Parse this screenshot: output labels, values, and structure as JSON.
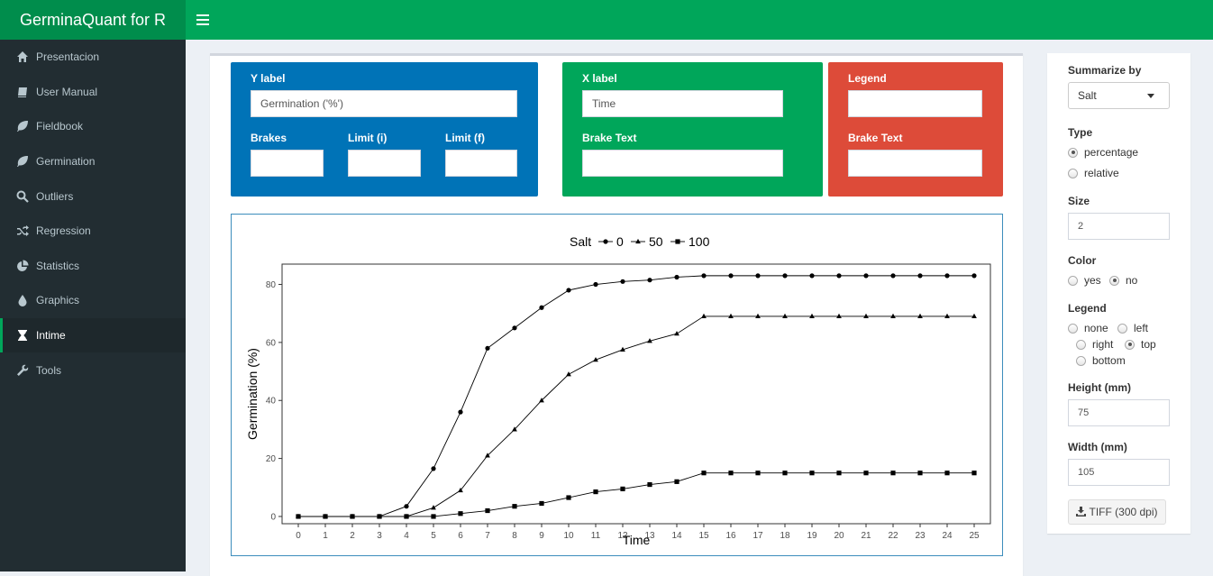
{
  "app": {
    "title": "GerminaQuant for R"
  },
  "sidebar": {
    "items": [
      {
        "label": "Presentacion",
        "icon": "home-icon"
      },
      {
        "label": "User Manual",
        "icon": "book-icon"
      },
      {
        "label": "Fieldbook",
        "icon": "leaf-icon"
      },
      {
        "label": "Germination",
        "icon": "leaf-icon"
      },
      {
        "label": "Outliers",
        "icon": "search-icon"
      },
      {
        "label": "Regression",
        "icon": "random-icon"
      },
      {
        "label": "Statistics",
        "icon": "pie-chart-icon"
      },
      {
        "label": "Graphics",
        "icon": "tint-icon"
      },
      {
        "label": "Intime",
        "icon": "hourglass-icon"
      },
      {
        "label": "Tools",
        "icon": "wrench-icon"
      }
    ],
    "active": "Intime"
  },
  "ylabel_panel": {
    "title": "Y label",
    "value": "Germination ('%')",
    "brakes_label": "Brakes",
    "limit_i_label": "Limit (i)",
    "limit_f_label": "Limit (f)",
    "brakes_value": "",
    "limit_i_value": "",
    "limit_f_value": ""
  },
  "xlabel_panel": {
    "title": "X label",
    "value": "Time",
    "brake_text_label": "Brake Text",
    "brake_text_value": ""
  },
  "legend_panel": {
    "title": "Legend",
    "value": "",
    "brake_text_label": "Brake Text",
    "brake_text_value": ""
  },
  "controls": {
    "summarize_label": "Summarize by",
    "summarize_value": "Salt",
    "type_label": "Type",
    "type_options": [
      "percentage",
      "relative"
    ],
    "type_selected": "percentage",
    "size_label": "Size",
    "size_value": "2",
    "color_label": "Color",
    "color_options": [
      "yes",
      "no"
    ],
    "color_selected": "no",
    "legend_label": "Legend",
    "legend_options": [
      "none",
      "left",
      "right",
      "top",
      "bottom"
    ],
    "legend_selected": "top",
    "height_label": "Height (mm)",
    "height_value": "75",
    "width_label": "Width (mm)",
    "width_value": "105",
    "download_label": "TIFF (300 dpi)"
  },
  "colors": {
    "header": "#00a65a",
    "logo_bg": "#008d4c",
    "sidebar": "#222d32",
    "panel_blue": "#0073b7",
    "panel_green": "#00a65a",
    "panel_red": "#dd4b39"
  },
  "chart_data": {
    "type": "line",
    "xlabel": "Time",
    "ylabel": "Germination (%)",
    "legend_title": "Salt",
    "legend_position": "top",
    "x": [
      0,
      1,
      2,
      3,
      4,
      5,
      6,
      7,
      8,
      9,
      10,
      11,
      12,
      13,
      14,
      15,
      16,
      17,
      18,
      19,
      20,
      21,
      22,
      23,
      24,
      25
    ],
    "xlim": [
      -0.6,
      25.6
    ],
    "ylim": [
      -2.5,
      87
    ],
    "yticks": [
      0,
      20,
      40,
      60,
      80
    ],
    "series": [
      {
        "name": "0",
        "marker": "circle",
        "values": [
          0,
          0,
          0,
          0,
          3.5,
          16.5,
          36,
          58,
          65,
          72,
          78,
          80,
          81,
          81.5,
          82.5,
          83,
          83,
          83,
          83,
          83,
          83,
          83,
          83,
          83,
          83,
          83
        ]
      },
      {
        "name": "50",
        "marker": "triangle",
        "values": [
          0,
          0,
          0,
          0,
          0,
          3,
          9,
          21,
          30,
          40,
          49,
          54,
          57.5,
          60.5,
          63,
          69,
          69,
          69,
          69,
          69,
          69,
          69,
          69,
          69,
          69,
          69
        ]
      },
      {
        "name": "100",
        "marker": "square",
        "values": [
          0,
          0,
          0,
          0,
          0,
          0,
          1,
          2,
          3.5,
          4.5,
          6.5,
          8.5,
          9.5,
          11,
          12,
          15,
          15,
          15,
          15,
          15,
          15,
          15,
          15,
          15,
          15,
          15
        ]
      }
    ]
  }
}
